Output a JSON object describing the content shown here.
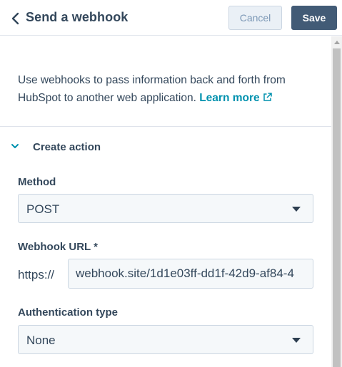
{
  "header": {
    "title": "Send a webhook",
    "cancel_label": "Cancel",
    "save_label": "Save"
  },
  "intro": {
    "text": "Use webhooks to pass information back and forth from HubSpot to another web application. ",
    "link_label": "Learn more"
  },
  "section": {
    "title": "Create action",
    "expanded": true
  },
  "method": {
    "label": "Method",
    "value": "POST"
  },
  "webhook_url": {
    "label": "Webhook URL *",
    "prefix": "https://",
    "value": "webhook.site/1d1e03ff-dd1f-42d9-af84-4"
  },
  "auth": {
    "label": "Authentication type",
    "value": "None"
  },
  "colors": {
    "text": "#33475b",
    "link": "#0091ae",
    "save_button": "#425b76",
    "cancel_button": "#eaf0f6",
    "input_bg": "#f5f8fa",
    "border": "#cbd6e2"
  },
  "icons": {
    "back": "chevron-left-icon",
    "external_link": "external-link-icon",
    "section_toggle": "chevron-down-icon",
    "select_caret": "caret-down-icon"
  }
}
